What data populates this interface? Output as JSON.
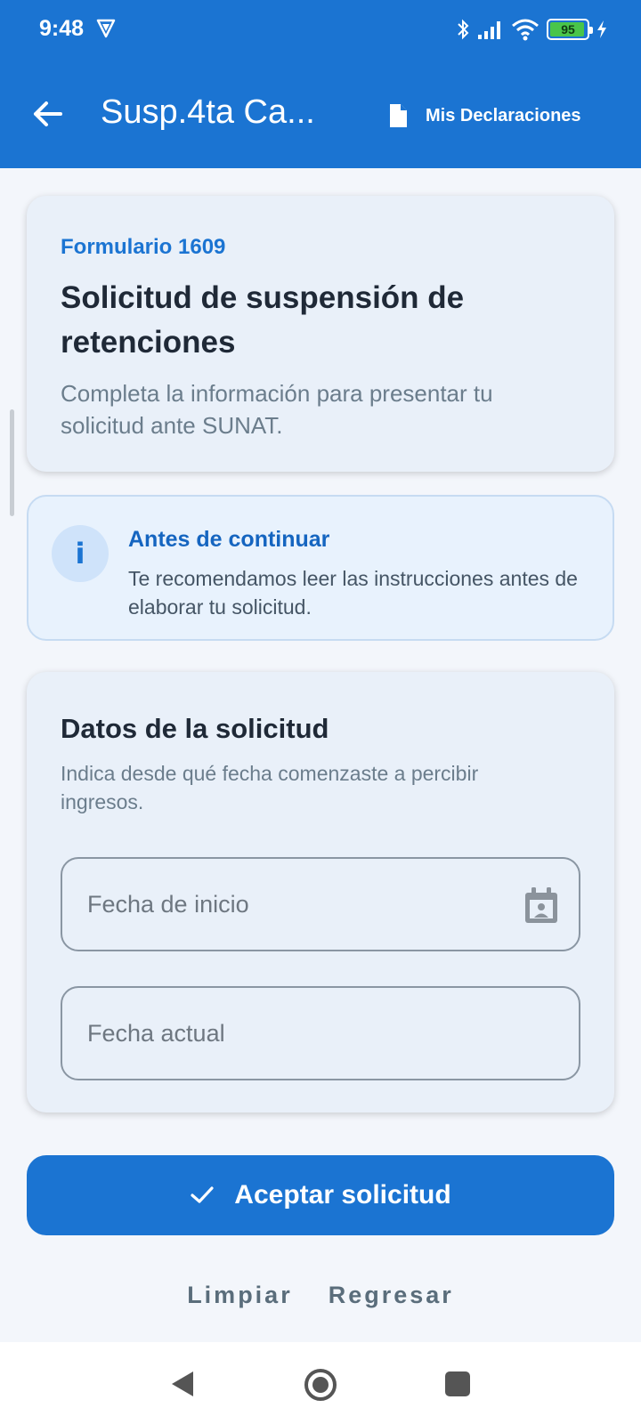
{
  "status_bar": {
    "time": "9:48",
    "battery": "95",
    "battery_level": 0.95
  },
  "app_bar": {
    "title": "Susp.4ta Ca...",
    "declarations_label": "Mis Declaraciones"
  },
  "form_card": {
    "kicker": "Formulario 1609",
    "title": "Solicitud de suspensión de retenciones",
    "subtitle": "Completa la información para presentar tu solicitud ante SUNAT."
  },
  "info_card": {
    "icon": "i",
    "title": "Antes de continuar",
    "text": "Te recomendamos leer las instrucciones antes de elaborar tu solicitud."
  },
  "data_card": {
    "title": "Datos de la solicitud",
    "subtitle": "Indica desde qué fecha comenzaste a percibir ingresos.",
    "start_date": {
      "placeholder": "Fecha de inicio",
      "value": ""
    },
    "current_date": {
      "placeholder": "Fecha actual",
      "value": ""
    }
  },
  "actions": {
    "accept": "Aceptar solicitud",
    "clear": "Limpiar",
    "back": "Regresar"
  },
  "colors": {
    "primary": "#1b74d2",
    "card": "#e9f0f9",
    "info_bg": "#e8f2fd",
    "background": "#f3f6fb"
  }
}
